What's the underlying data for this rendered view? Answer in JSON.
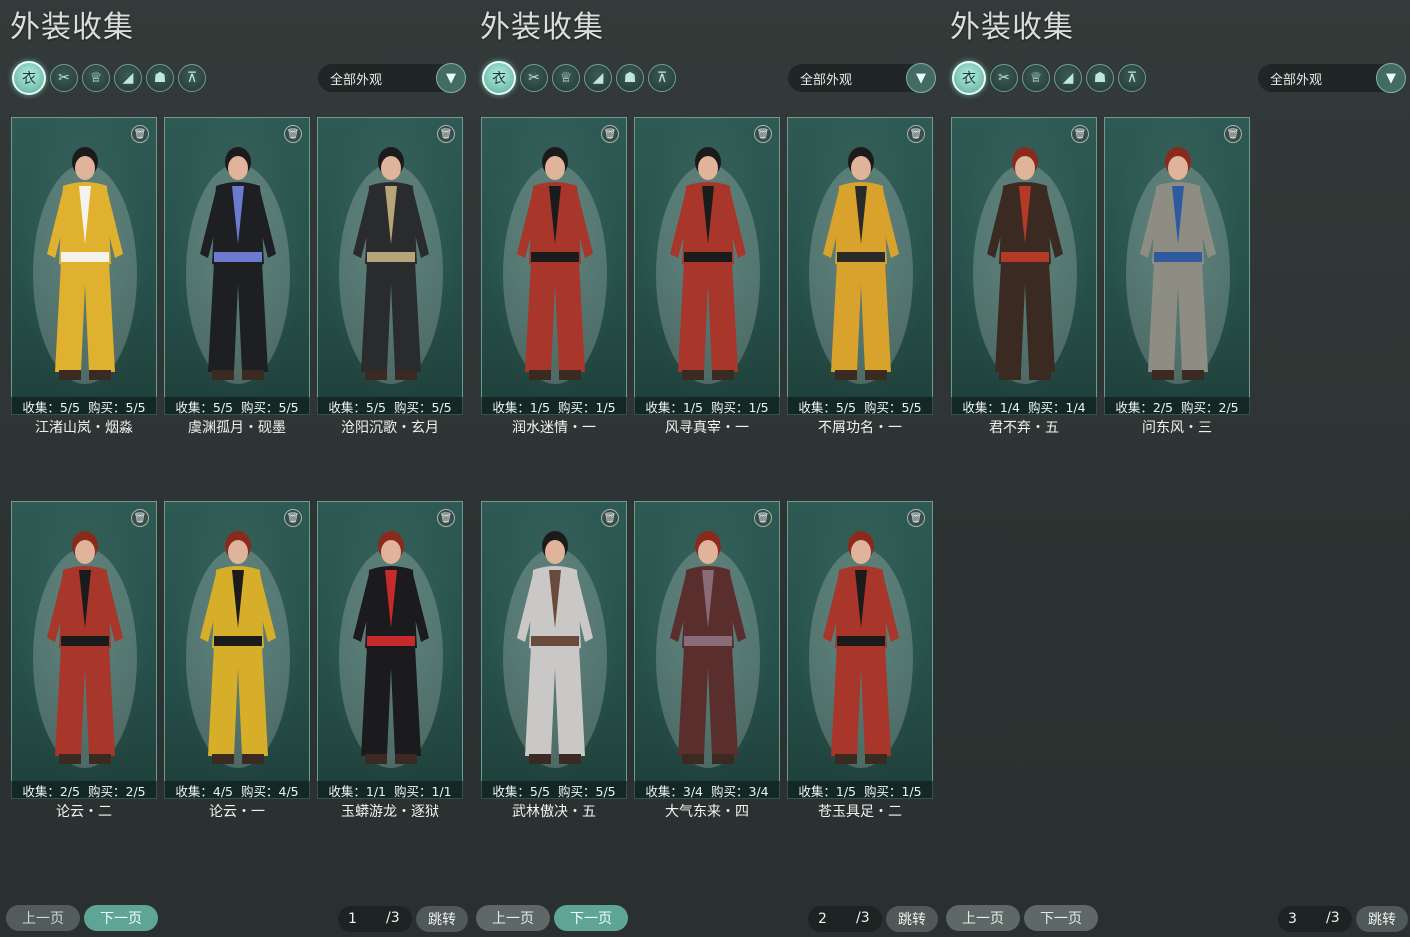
{
  "panels": [
    {
      "title": "外装收集",
      "filter": "全部外观",
      "prev": "上一页",
      "next": "下一页",
      "page": "1",
      "total": "/3",
      "jump": "跳转",
      "cards": [
        {
          "name": "江渚山岚・烟淼",
          "collect": "收集：5/5",
          "buy": "购买：5/5",
          "outfit": "#e0b12e",
          "trim": "#f4f2ea",
          "hair": "#1c1a1a"
        },
        {
          "name": "虞渊孤月・砚墨",
          "collect": "收集：5/5",
          "buy": "购买：5/5",
          "outfit": "#1e1f22",
          "trim": "#6c7bd0",
          "hair": "#1c1a1a"
        },
        {
          "name": "沧阳沉歌・玄月",
          "collect": "收集：5/5",
          "buy": "购买：5/5",
          "outfit": "#2a2b2c",
          "trim": "#b7a479",
          "hair": "#1c1a1a"
        },
        {
          "name": "论云・二",
          "collect": "收集：2/5",
          "buy": "购买：2/5",
          "outfit": "#a8362a",
          "trim": "#1b1b1b",
          "hair": "#8a2a1c"
        },
        {
          "name": "论云・一",
          "collect": "收集：4/5",
          "buy": "购买：4/5",
          "outfit": "#d6ae2a",
          "trim": "#1b1b1b",
          "hair": "#8a2a1c"
        },
        {
          "name": "玉蟒游龙・逐狱",
          "collect": "收集：1/1",
          "buy": "购买：1/1",
          "outfit": "#1b1a1c",
          "trim": "#c62a2a",
          "hair": "#8a2a1c"
        }
      ]
    },
    {
      "title": "外装收集",
      "filter": "全部外观",
      "prev": "上一页",
      "next": "下一页",
      "page": "2",
      "total": "/3",
      "jump": "跳转",
      "cards": [
        {
          "name": "润水迷情・一",
          "collect": "收集：1/5",
          "buy": "购买：1/5",
          "outfit": "#a8362a",
          "trim": "#1b1b1b",
          "hair": "#1c1a1a"
        },
        {
          "name": "风寻真宰・一",
          "collect": "收集：1/5",
          "buy": "购买：1/5",
          "outfit": "#a8362a",
          "trim": "#1b1b1b",
          "hair": "#1c1a1a"
        },
        {
          "name": "不屑功名・一",
          "collect": "收集：5/5",
          "buy": "购买：5/5",
          "outfit": "#d9a22c",
          "trim": "#2a2a2a",
          "hair": "#1c1a1a"
        },
        {
          "name": "武林傲决・五",
          "collect": "收集：5/5",
          "buy": "购买：5/5",
          "outfit": "#c9c8c6",
          "trim": "#6a4a3a",
          "hair": "#1c1a1a"
        },
        {
          "name": "大气东来・四",
          "collect": "收集：3/4",
          "buy": "购买：3/4",
          "outfit": "#5a2e2c",
          "trim": "#8a6b78",
          "hair": "#8a2a1c"
        },
        {
          "name": "苍玉具足・二",
          "collect": "收集：1/5",
          "buy": "购买：1/5",
          "outfit": "#a8362a",
          "trim": "#1b1b1b",
          "hair": "#8a2a1c"
        }
      ]
    },
    {
      "title": "外装收集",
      "filter": "全部外观",
      "prev": "上一页",
      "next": "下一页",
      "page": "3",
      "total": "/3",
      "jump": "跳转",
      "cards": [
        {
          "name": "君不弃・五",
          "collect": "收集：1/4",
          "buy": "购买：1/4",
          "outfit": "#3a2a22",
          "trim": "#b23a26",
          "hair": "#8a2a1c"
        },
        {
          "name": "问东风・三",
          "collect": "收集：2/5",
          "buy": "购买：2/5",
          "outfit": "#8d8d84",
          "trim": "#2f5aa0",
          "hair": "#8a2a1c"
        }
      ]
    }
  ],
  "category_icons": [
    "outfit-icon",
    "hair-icon",
    "top-icon",
    "shoes-icon",
    "mask-icon",
    "pants-icon"
  ]
}
